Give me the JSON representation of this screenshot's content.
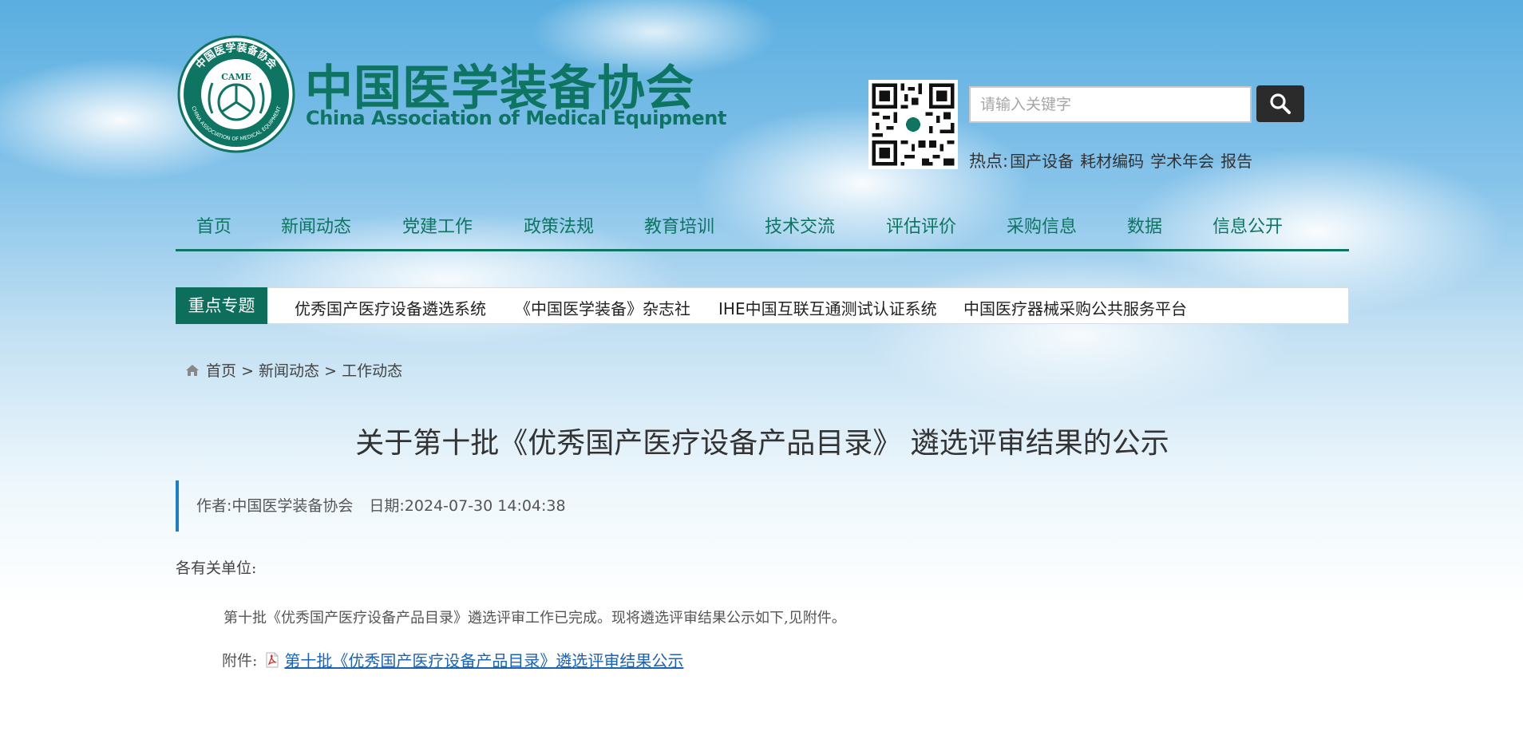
{
  "header": {
    "logo_badge_text": "CAME",
    "logo_ring_text_cn": "中国医学装备协会",
    "logo_ring_text_en": "CHINA ASSOCIATION OF MEDICAL EQUIPMENT",
    "org_name_cn": "中国医学装备协会",
    "org_name_en": "China Association of Medical Equipment"
  },
  "search": {
    "placeholder": "请输入关键字",
    "value": ""
  },
  "hot": {
    "label": "热点:",
    "items": [
      "国产设备",
      "耗材编码",
      "学术年会",
      "报告"
    ]
  },
  "nav": {
    "items": [
      "首页",
      "新闻动态",
      "党建工作",
      "政策法规",
      "教育培训",
      "技术交流",
      "评估评价",
      "采购信息",
      "数据",
      "信息公开"
    ]
  },
  "focus": {
    "tag": "重点专题",
    "links": [
      "优秀国产医疗设备遴选系统",
      "《中国医学装备》杂志社",
      "IHE中国互联互通测试认证系统",
      "中国医疗器械采购公共服务平台"
    ]
  },
  "breadcrumb": {
    "items": [
      "首页",
      "新闻动态",
      "工作动态"
    ],
    "separator": ">"
  },
  "article": {
    "title": "关于第十批《优秀国产医疗设备产品目录》 遴选评审结果的公示",
    "author": "作者:中国医学装备协会",
    "date": "日期:2024-07-30 14:04:38",
    "salutation": "各有关单位:",
    "paragraph": "第十批《优秀国产医疗设备产品目录》遴选评审工作已完成。现将遴选评审结果公示如下,见附件。",
    "attachment_label": "附件:",
    "attachment_link": "第十批《优秀国产医疗设备产品目录》遴选评审结果公示"
  },
  "colors": {
    "brand_green": "#0d7561",
    "focus_tag_bg": "#0d6e5c",
    "meta_accent": "#1d7ec6",
    "link_blue": "#1b63b8"
  },
  "icons": {
    "search": "magnifier-icon",
    "home": "home-icon",
    "attachment": "pdf-icon"
  }
}
